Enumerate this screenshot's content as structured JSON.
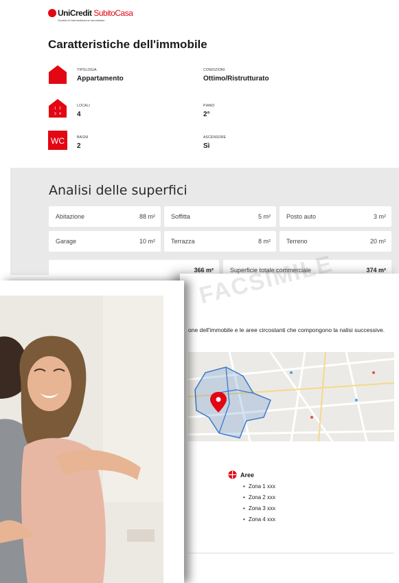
{
  "header": {
    "logo_brand": "UniCredit",
    "logo_product": "SubitoCasa",
    "logo_subtitle": "Società di intermediazione immobiliare"
  },
  "caratteristiche": {
    "title": "Caratteristiche dell'immobile",
    "items": [
      {
        "label": "TIPOLOGIA",
        "value": "Appartamento",
        "icon": "house-icon"
      },
      {
        "label": "CONDIZIONI",
        "value": "Ottimo/Ristrutturato"
      },
      {
        "label": "LOCALI",
        "value": "4",
        "icon": "rooms-house-icon"
      },
      {
        "label": "PIANO",
        "value": "2°"
      },
      {
        "label": "BAGNI",
        "value": "2",
        "icon": "wc-icon"
      },
      {
        "label": "ASCENSORE",
        "value": "Sì"
      }
    ],
    "icon_color": "#e30613"
  },
  "analisi": {
    "title": "Analisi delle superfici",
    "rows": [
      [
        {
          "label": "Abitazione",
          "value": "88 m²"
        },
        {
          "label": "Soffitta",
          "value": "5 m²"
        },
        {
          "label": "Posto auto",
          "value": "3 m²"
        }
      ],
      [
        {
          "label": "Garage",
          "value": "10 m²"
        },
        {
          "label": "Terrazza",
          "value": "8 m²"
        },
        {
          "label": "Terreno",
          "value": "20 m²"
        }
      ]
    ],
    "totals": [
      {
        "label": "",
        "value": "366 m²"
      },
      {
        "label": "Superficie totale commerciale",
        "value": "374 m²"
      }
    ]
  },
  "watermark": "FACSIMILE",
  "mappa": {
    "intro": "one dell'immobile e le aree circostanti che compongono la nalisi successive.",
    "legend_title": "Aree",
    "legend_items": [
      "Zona 1 xxx",
      "Zona 2 xxx",
      "Zona 3 xxx",
      "Zona 4 xxx"
    ],
    "area_color": "#3a79c9",
    "pin_color": "#e30613"
  }
}
